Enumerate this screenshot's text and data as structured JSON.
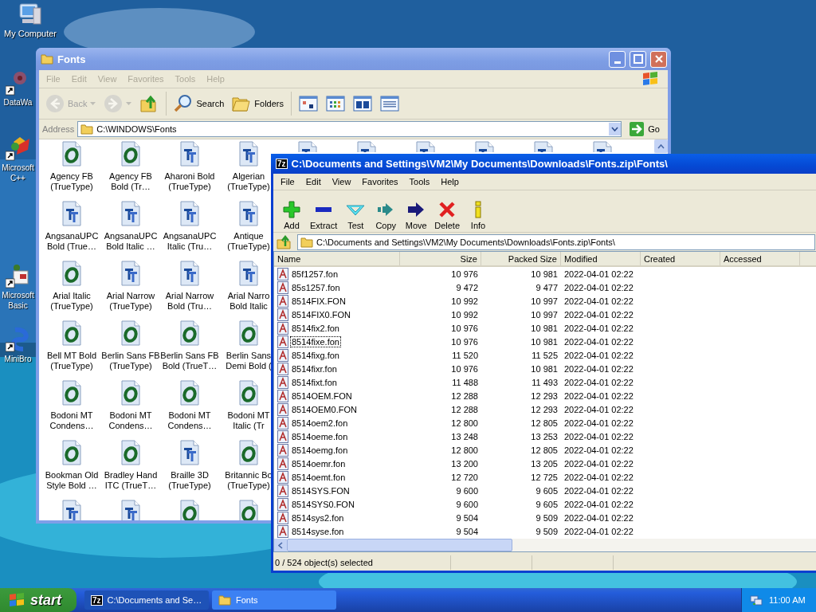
{
  "desktop_icons": [
    {
      "label": "My Computer",
      "kind": "computer",
      "shortcut": false
    },
    {
      "label": "DataWa",
      "kind": "flower",
      "shortcut": true
    },
    {
      "label": "Microsoft\nC++",
      "kind": "cpp",
      "shortcut": true
    },
    {
      "label": "Microsoft\nBasic",
      "kind": "basic",
      "shortcut": true
    },
    {
      "label": "MiniBro",
      "kind": "browser",
      "shortcut": true
    }
  ],
  "fonts_window": {
    "title": "Fonts",
    "active": false,
    "menu": [
      "File",
      "Edit",
      "View",
      "Favorites",
      "Tools",
      "Help"
    ],
    "toolbar": [
      {
        "kind": "back",
        "label": "Back",
        "disabled": true
      },
      {
        "kind": "forward",
        "disabled": true
      },
      {
        "kind": "up",
        "disabled": false
      },
      {
        "kind": "search",
        "label": "Search",
        "disabled": false
      },
      {
        "kind": "folders",
        "label": "Folders",
        "disabled": false
      },
      {
        "kind": "thumbnails",
        "disabled": false
      },
      {
        "kind": "tiles",
        "disabled": false
      },
      {
        "kind": "icons",
        "disabled": false
      },
      {
        "kind": "details",
        "disabled": false
      }
    ],
    "address": {
      "label": "Address",
      "value": "C:\\WINDOWS\\Fonts",
      "go": "Go"
    },
    "rows": [
      [
        {
          "label": "Agency FB\n(TrueType)",
          "kind": "opentype"
        },
        {
          "label": "Agency FB\nBold (Tr…",
          "kind": "opentype"
        },
        {
          "label": "Aharoni Bold\n(TrueType)",
          "kind": "truetype"
        },
        {
          "label": "Algerian\n(TrueType)",
          "kind": "truetype"
        },
        {
          "kind": "truetype"
        },
        {
          "kind": "truetype"
        },
        {
          "kind": "truetype"
        },
        {
          "kind": "truetype"
        },
        {
          "kind": "truetype"
        },
        {
          "kind": "truetype"
        }
      ],
      [
        {
          "label": "AngsanaUPC\nBold (True…",
          "kind": "truetype"
        },
        {
          "label": "AngsanaUPC\nBold Italic …",
          "kind": "truetype"
        },
        {
          "label": "AngsanaUPC\nItalic (Tru…",
          "kind": "truetype"
        },
        {
          "label": "Antique\n(TrueType)",
          "kind": "truetype"
        }
      ],
      [
        {
          "label": "Arial Italic\n(TrueType)",
          "kind": "opentype"
        },
        {
          "label": "Arial Narrow\n(TrueType)",
          "kind": "truetype"
        },
        {
          "label": "Arial Narrow\nBold (Tru…",
          "kind": "truetype"
        },
        {
          "label": "Arial Narro\nBold Italic",
          "kind": "truetype"
        }
      ],
      [
        {
          "label": "Bell MT Bold\n(TrueType)",
          "kind": "opentype"
        },
        {
          "label": "Berlin Sans FB\n(TrueType)",
          "kind": "opentype"
        },
        {
          "label": "Berlin Sans FB\nBold (TrueT…",
          "kind": "opentype"
        },
        {
          "label": "Berlin Sans\nDemi Bold (",
          "kind": "opentype"
        }
      ],
      [
        {
          "label": "Bodoni MT\nCondens…",
          "kind": "opentype"
        },
        {
          "label": "Bodoni MT\nCondens…",
          "kind": "opentype"
        },
        {
          "label": "Bodoni MT\nCondens…",
          "kind": "opentype"
        },
        {
          "label": "Bodoni MT\nItalic (Tr",
          "kind": "opentype"
        }
      ],
      [
        {
          "label": "Bookman Old\nStyle Bold …",
          "kind": "opentype"
        },
        {
          "label": "Bradley Hand\nITC (TrueT…",
          "kind": "opentype"
        },
        {
          "label": "Braille 3D\n(TrueType)",
          "kind": "truetype"
        },
        {
          "label": "Britannic Bo\n(TrueType)",
          "kind": "opentype"
        }
      ],
      [
        {
          "kind": "truetype"
        },
        {
          "kind": "truetype"
        },
        {
          "kind": "opentype"
        },
        {
          "kind": "opentype"
        }
      ]
    ]
  },
  "archive_window": {
    "icon_text": "7z",
    "title": "C:\\Documents and Settings\\VM2\\My Documents\\Downloads\\Fonts.zip\\Fonts\\",
    "active": true,
    "menu": [
      "File",
      "Edit",
      "View",
      "Favorites",
      "Tools",
      "Help"
    ],
    "toolbar": [
      {
        "kind": "add",
        "label": "Add"
      },
      {
        "kind": "extract",
        "label": "Extract"
      },
      {
        "kind": "test",
        "label": "Test"
      },
      {
        "kind": "copy",
        "label": "Copy"
      },
      {
        "kind": "move",
        "label": "Move"
      },
      {
        "kind": "delete",
        "label": "Delete"
      },
      {
        "kind": "info",
        "label": "Info"
      }
    ],
    "address": "C:\\Documents and Settings\\VM2\\My Documents\\Downloads\\Fonts.zip\\Fonts\\",
    "columns": [
      "Name",
      "Size",
      "Packed Size",
      "Modified",
      "Created",
      "Accessed"
    ],
    "rows": [
      {
        "name": "85f1257.fon",
        "size": "10 976",
        "packed": "10 981",
        "modified": "2022-04-01 02:22",
        "focused": false
      },
      {
        "name": "85s1257.fon",
        "size": "9 472",
        "packed": "9 477",
        "modified": "2022-04-01 02:22",
        "focused": false
      },
      {
        "name": "8514FIX.FON",
        "size": "10 992",
        "packed": "10 997",
        "modified": "2022-04-01 02:22",
        "focused": false
      },
      {
        "name": "8514FIX0.FON",
        "size": "10 992",
        "packed": "10 997",
        "modified": "2022-04-01 02:22",
        "focused": false
      },
      {
        "name": "8514fix2.fon",
        "size": "10 976",
        "packed": "10 981",
        "modified": "2022-04-01 02:22",
        "focused": false
      },
      {
        "name": "8514fixe.fon",
        "size": "10 976",
        "packed": "10 981",
        "modified": "2022-04-01 02:22",
        "focused": true
      },
      {
        "name": "8514fixg.fon",
        "size": "11 520",
        "packed": "11 525",
        "modified": "2022-04-01 02:22",
        "focused": false
      },
      {
        "name": "8514fixr.fon",
        "size": "10 976",
        "packed": "10 981",
        "modified": "2022-04-01 02:22",
        "focused": false
      },
      {
        "name": "8514fixt.fon",
        "size": "11 488",
        "packed": "11 493",
        "modified": "2022-04-01 02:22",
        "focused": false
      },
      {
        "name": "8514OEM.FON",
        "size": "12 288",
        "packed": "12 293",
        "modified": "2022-04-01 02:22",
        "focused": false
      },
      {
        "name": "8514OEM0.FON",
        "size": "12 288",
        "packed": "12 293",
        "modified": "2022-04-01 02:22",
        "focused": false
      },
      {
        "name": "8514oem2.fon",
        "size": "12 800",
        "packed": "12 805",
        "modified": "2022-04-01 02:22",
        "focused": false
      },
      {
        "name": "8514oeme.fon",
        "size": "13 248",
        "packed": "13 253",
        "modified": "2022-04-01 02:22",
        "focused": false
      },
      {
        "name": "8514oemg.fon",
        "size": "12 800",
        "packed": "12 805",
        "modified": "2022-04-01 02:22",
        "focused": false
      },
      {
        "name": "8514oemr.fon",
        "size": "13 200",
        "packed": "13 205",
        "modified": "2022-04-01 02:22",
        "focused": false
      },
      {
        "name": "8514oemt.fon",
        "size": "12 720",
        "packed": "12 725",
        "modified": "2022-04-01 02:22",
        "focused": false
      },
      {
        "name": "8514SYS.FON",
        "size": "9 600",
        "packed": "9 605",
        "modified": "2022-04-01 02:22",
        "focused": false
      },
      {
        "name": "8514SYS0.FON",
        "size": "9 600",
        "packed": "9 605",
        "modified": "2022-04-01 02:22",
        "focused": false
      },
      {
        "name": "8514sys2.fon",
        "size": "9 504",
        "packed": "9 509",
        "modified": "2022-04-01 02:22",
        "focused": false
      },
      {
        "name": "8514syse.fon",
        "size": "9 504",
        "packed": "9 509",
        "modified": "2022-04-01 02:22",
        "focused": false
      }
    ],
    "status": "0 / 524 object(s) selected"
  },
  "taskbar": {
    "start": "start",
    "tasks": [
      {
        "kind": "archive",
        "icon_text": "7z",
        "label": "C:\\Documents and Se…",
        "selected": true
      },
      {
        "kind": "folder",
        "label": "Fonts",
        "selected": false
      }
    ],
    "clock": "11:00 AM"
  }
}
